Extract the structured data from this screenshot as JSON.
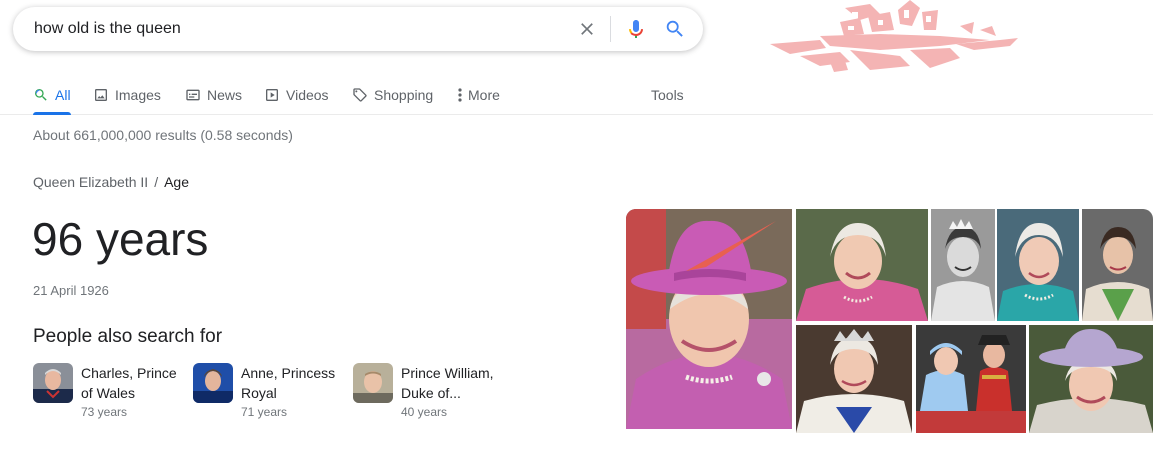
{
  "search": {
    "query": "how old is the queen",
    "clear_icon": "close-icon",
    "mic_icon": "microphone-icon",
    "search_icon": "search-icon"
  },
  "tabs": [
    {
      "label": "All",
      "icon": "search-icon",
      "active": true
    },
    {
      "label": "Images",
      "icon": "image-icon"
    },
    {
      "label": "News",
      "icon": "news-icon"
    },
    {
      "label": "Videos",
      "icon": "play-icon"
    },
    {
      "label": "Shopping",
      "icon": "tag-icon"
    },
    {
      "label": "More",
      "icon": "more-vert-icon"
    }
  ],
  "tools_label": "Tools",
  "result_stats": "About 661,000,000 results (0.58 seconds)",
  "breadcrumb": {
    "entity": "Queen Elizabeth II",
    "separator": "/",
    "attribute": "Age"
  },
  "answer": "96 years",
  "birthdate": "21 April 1926",
  "people_also_search": {
    "title": "People also search for",
    "items": [
      {
        "name": "Charles, Prince of Wales",
        "age": "73 years"
      },
      {
        "name": "Anne, Princess Royal",
        "age": "71 years"
      },
      {
        "name": "Prince William, Duke of...",
        "age": "40 years"
      }
    ]
  },
  "colors": {
    "accent": "#1a73e8",
    "mic_red": "#ea4335",
    "doodle_pink": "#f4b4b4"
  }
}
